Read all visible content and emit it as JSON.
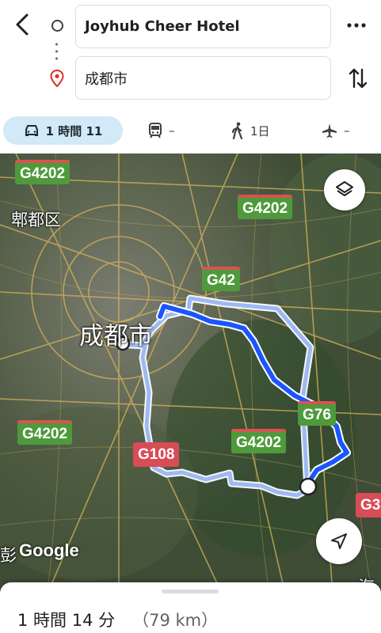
{
  "header": {
    "origin": "Joyhub Cheer Hotel",
    "destination": "成都市",
    "back_icon": "chevron-left-icon",
    "more_icon": "more-horiz-icon",
    "swap_icon": "swap-vertical-icon"
  },
  "modes": [
    {
      "name": "drive",
      "label": "1 時間 11",
      "icon": "car-icon",
      "active": true
    },
    {
      "name": "transit",
      "label": "–",
      "icon": "train-icon"
    },
    {
      "name": "walk",
      "label": "1日",
      "icon": "walk-icon"
    },
    {
      "name": "flight",
      "label": "–",
      "icon": "airplane-icon"
    }
  ],
  "map": {
    "road_shields": [
      "G4202",
      "G4202",
      "G42",
      "G4202",
      "G108",
      "G4202",
      "G76",
      "G3"
    ],
    "places": {
      "city": "成都市",
      "district": "郫都区",
      "partial_left": "彭",
      "partial_bottom_right": "海"
    },
    "attribution": "Google",
    "route_color": "#1a56ff",
    "alt_route_color": "#9db9f5"
  },
  "summary": {
    "duration": "1 時間 14 分",
    "distance": "（79 km）"
  }
}
